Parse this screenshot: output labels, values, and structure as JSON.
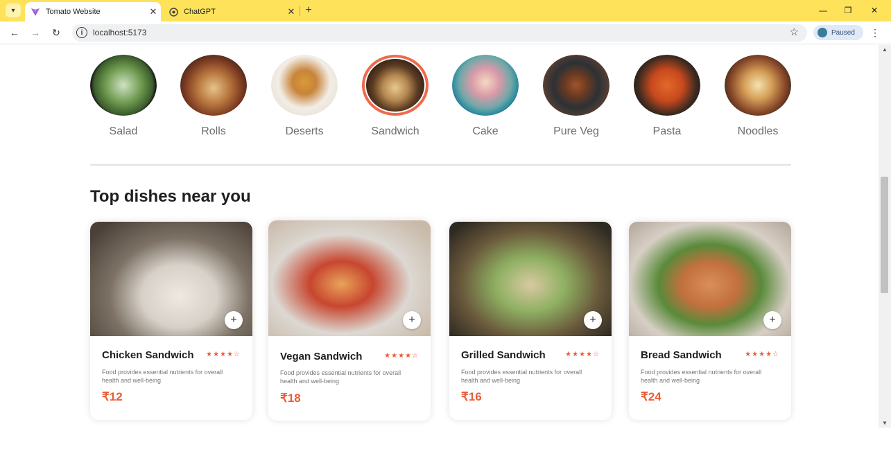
{
  "browser": {
    "tabs": [
      {
        "title": "Tomato Website",
        "active": true
      },
      {
        "title": "ChatGPT",
        "active": false
      }
    ],
    "url": "localhost:5173",
    "profile_status": "Paused"
  },
  "categories": [
    {
      "label": "Salad",
      "selected": false
    },
    {
      "label": "Rolls",
      "selected": false
    },
    {
      "label": "Deserts",
      "selected": false
    },
    {
      "label": "Sandwich",
      "selected": true
    },
    {
      "label": "Cake",
      "selected": false
    },
    {
      "label": "Pure Veg",
      "selected": false
    },
    {
      "label": "Pasta",
      "selected": false
    },
    {
      "label": "Noodles",
      "selected": false
    }
  ],
  "section": {
    "heading": "Top dishes near you"
  },
  "dishes": [
    {
      "name": "Chicken Sandwich",
      "rating": "★★★★☆",
      "description": "Food provides essential nutrients for overall health and well-being",
      "price": "₹12"
    },
    {
      "name": "Vegan Sandwich",
      "rating": "★★★★☆",
      "description": "Food provides essential nutrients for overall health and well-being",
      "price": "₹18"
    },
    {
      "name": "Grilled Sandwich",
      "rating": "★★★★☆",
      "description": "Food provides essential nutrients for overall health and well-being",
      "price": "₹16"
    },
    {
      "name": "Bread Sandwich",
      "rating": "★★★★☆",
      "description": "Food provides essential nutrients for overall health and well-being",
      "price": "₹24"
    }
  ],
  "colors": {
    "accent": "#ec5a35",
    "tabbar": "#fde25a",
    "selected_ring": "#ee6a4c"
  }
}
